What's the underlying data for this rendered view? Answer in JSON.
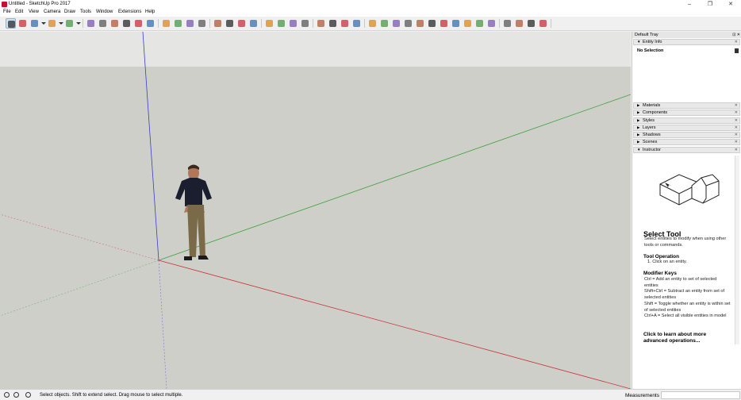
{
  "window": {
    "title": "Untitled - SketchUp Pro 2017"
  },
  "menu": [
    "File",
    "Edit",
    "View",
    "Camera",
    "Draw",
    "Tools",
    "Window",
    "Extensions",
    "Help"
  ],
  "toolbar": {
    "groups": [
      [
        "select-icon",
        "eraser-icon",
        "line-icon",
        "dropdown-arrow-icon",
        "arc-icon",
        "dropdown-arrow-icon",
        "rectangle-icon",
        "dropdown-arrow-icon"
      ],
      [
        "push-pull-icon",
        "follow-me-icon",
        "move-icon",
        "rotate-icon",
        "scale-icon",
        "offset-icon"
      ],
      [
        "tape-measure-icon",
        "protractor-icon",
        "dimension-icon",
        "text-icon"
      ],
      [
        "orbit-icon",
        "pan-icon",
        "zoom-icon",
        "zoom-extents-icon"
      ],
      [
        "paint-bucket-icon",
        "component-icon",
        "material-icon",
        "warehouse-icon"
      ],
      [
        "sandbox-icon",
        "teapot-icon",
        "teapot2-icon",
        "camera-views-icon"
      ],
      [
        "section-icon",
        "display-icon",
        "style-icon",
        "style2-icon",
        "xray-icon",
        "backedges-icon",
        "wireframe-icon",
        "hidden-icon",
        "shaded-icon",
        "textured-icon",
        "monochrome-icon"
      ],
      [
        "terrain-icon",
        "smoove-icon",
        "stamp-icon",
        "drape-icon"
      ]
    ]
  },
  "tray": {
    "title": "Default Tray",
    "entity_info": {
      "label": "Entity Info",
      "value": "No Selection"
    },
    "panels": [
      "Materials",
      "Components",
      "Styles",
      "Layers",
      "Shadows",
      "Scenes",
      "Instructor"
    ],
    "instructor": {
      "tool_title": "Select Tool",
      "description": "Select entities to modify when using other tools or commands.",
      "operation_heading": "Tool Operation",
      "operation_step": "1.  Click on an entity.",
      "modifier_heading": "Modifier Keys",
      "modifiers": [
        "Ctrl = Add an entity to set of selected entities",
        "Shift+Ctrl = Subtract an entity from set of selected entities",
        "Shift = Toggle whether an entity is within set of selected entities",
        "Ctrl+A = Select all visible entities in model"
      ],
      "learn_more": "Click to learn about more advanced operations..."
    }
  },
  "status": {
    "message": "Select objects. Shift to extend select. Drag mouse to select multiple.",
    "measurements_label": "Measurements",
    "measurements_value": ""
  },
  "colors": {
    "sky": "#e5e5e3",
    "ground": "#cfcfca",
    "red_axis": "#c8323c",
    "green_axis": "#3ca03c",
    "blue_axis": "#3c3cc8",
    "selected_tool_bg": "#cce4f7"
  }
}
